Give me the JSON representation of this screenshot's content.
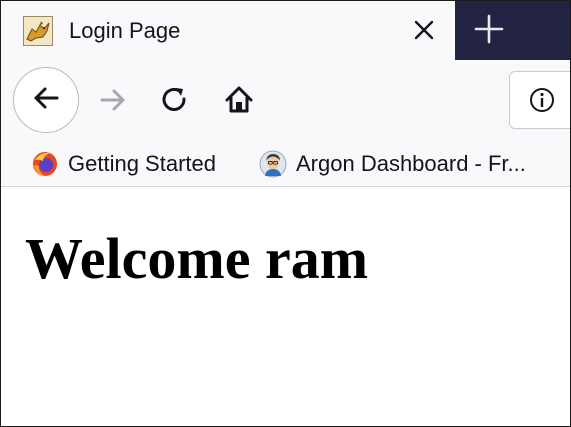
{
  "browser": {
    "tab": {
      "title": "Login Page",
      "close_icon": "close-icon",
      "favicon": "tomcat-favicon-icon"
    },
    "new_tab_icon": "plus-icon",
    "toolbar": {
      "back_icon": "arrow-left-icon",
      "forward_icon": "arrow-right-icon",
      "reload_icon": "reload-icon",
      "home_icon": "home-icon",
      "site_info_icon": "info-icon"
    },
    "bookmarks": [
      {
        "label": "Getting Started",
        "icon": "firefox-icon"
      },
      {
        "label": "Argon Dashboard - Fr...",
        "icon": "avatar-icon"
      }
    ]
  },
  "page": {
    "heading": "Welcome ram"
  },
  "colors": {
    "tabstrip_dark": "#232444",
    "toolbar_bg": "#f9f9fb",
    "text": "#15141a",
    "heading": "#000000"
  }
}
